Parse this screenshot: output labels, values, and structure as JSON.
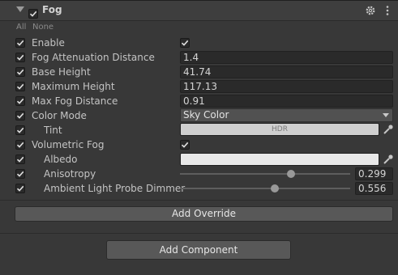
{
  "header": {
    "title": "Fog",
    "enabled": true,
    "icons": [
      "settings-icon",
      "more-icon"
    ]
  },
  "toggle_all": {
    "all_label": "All",
    "none_label": "None"
  },
  "properties": {
    "enable": {
      "label": "Enable",
      "value": true,
      "override": true
    },
    "attenuation": {
      "label": "Fog Attenuation Distance",
      "value": "1.4",
      "override": true
    },
    "base_height": {
      "label": "Base Height",
      "value": "41.74",
      "override": true
    },
    "max_height": {
      "label": "Maximum Height",
      "value": "117.13",
      "override": true
    },
    "max_distance": {
      "label": "Max Fog Distance",
      "value": "0.91",
      "override": true
    },
    "color_mode": {
      "label": "Color Mode",
      "value": "Sky Color",
      "override": true
    },
    "tint": {
      "label": "Tint",
      "value": "HDR",
      "override": true,
      "color": "#cfcfcf"
    },
    "volumetric": {
      "label": "Volumetric Fog",
      "value": true,
      "override": true
    },
    "albedo": {
      "label": "Albedo",
      "override": true,
      "color": "#e8e8e8"
    },
    "anisotropy": {
      "label": "Anisotropy",
      "value": "0.299",
      "override": true,
      "fraction": 0.65
    },
    "ambient_dimmer": {
      "label": "Ambient Light Probe Dimmer",
      "value": "0.556",
      "override": true,
      "fraction": 0.556
    }
  },
  "buttons": {
    "add_override": "Add Override",
    "add_component": "Add Component"
  },
  "colors": {
    "background": "#383838",
    "field": "#2a2a2a",
    "button": "#585858"
  }
}
